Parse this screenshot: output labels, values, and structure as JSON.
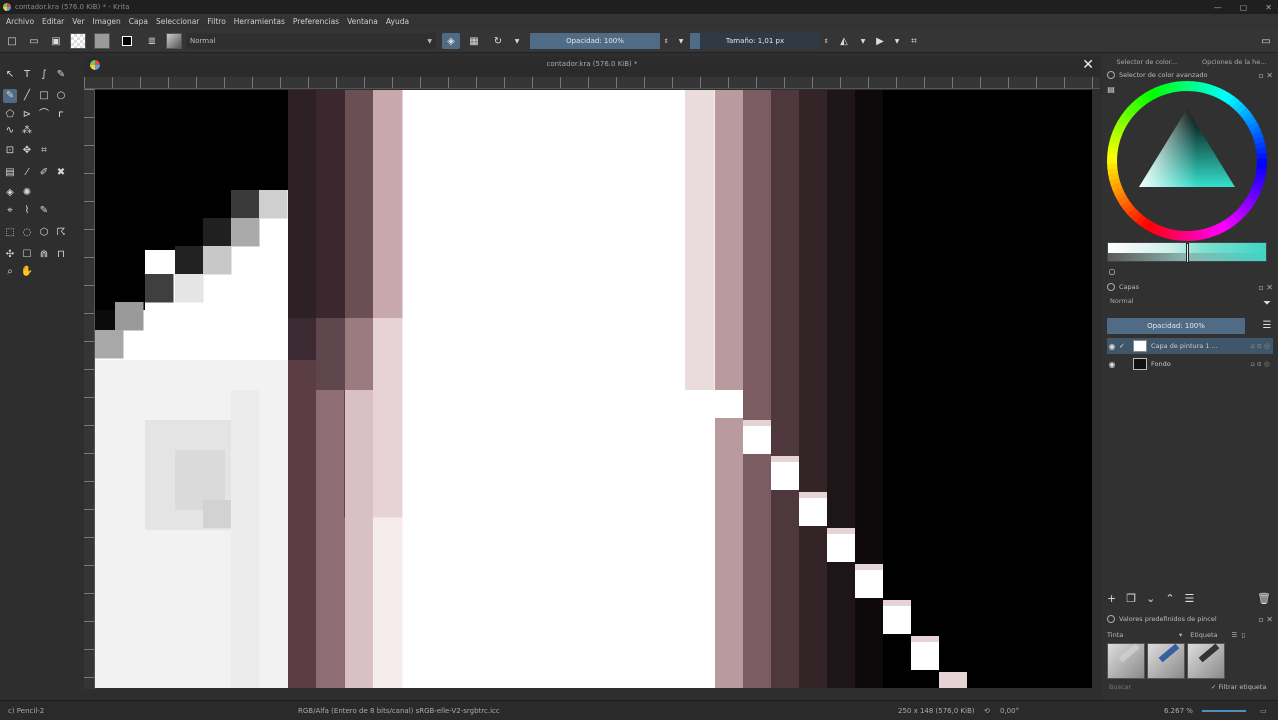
{
  "window": {
    "title": "contador.kra (576.0 KiB) * - Krita",
    "controls": [
      "—",
      "▢",
      "✕"
    ]
  },
  "menu": [
    "Archivo",
    "Editar",
    "Ver",
    "Imagen",
    "Capa",
    "Seleccionar",
    "Filtro",
    "Herramientas",
    "Preferencias",
    "Ventana",
    "Ayuda"
  ],
  "toolbar": {
    "blend_mode": "Normal",
    "opacity": "Opacidad: 100%",
    "size": "Tamaño: 1,01 px"
  },
  "document": {
    "tab_title": "contador.kra (576.0 KiB) *",
    "close_glyph": "✕"
  },
  "dock": {
    "tabs": [
      "Selector de color...",
      "Opciones de la he..."
    ],
    "color_selector_title": "Selector de color avanzado",
    "layers_title": "Capas",
    "layers_blend": "Normal",
    "layers_opacity": "Opacidad: 100%",
    "layers": [
      {
        "name": "Capa de pintura 1 ...",
        "selected": true
      },
      {
        "name": "Fondo",
        "selected": false
      }
    ],
    "presets_title": "Valores predefinidos de pincel",
    "presets_filter": "Tinta",
    "presets_tag": "Etiqueta",
    "search_placeholder": "Buscar",
    "filter_tag_label": "Filtrar etiqueta"
  },
  "status": {
    "brush": "c) Pencil-2",
    "color_space": "RGB/Alfa (Entero de 8 bits/canal)  sRGB-elle-V2-srgbtrc.icc",
    "dimensions": "250 x 148 (576,0 KiB)",
    "rotation": "0,00°",
    "zoom": "6.267 %"
  }
}
